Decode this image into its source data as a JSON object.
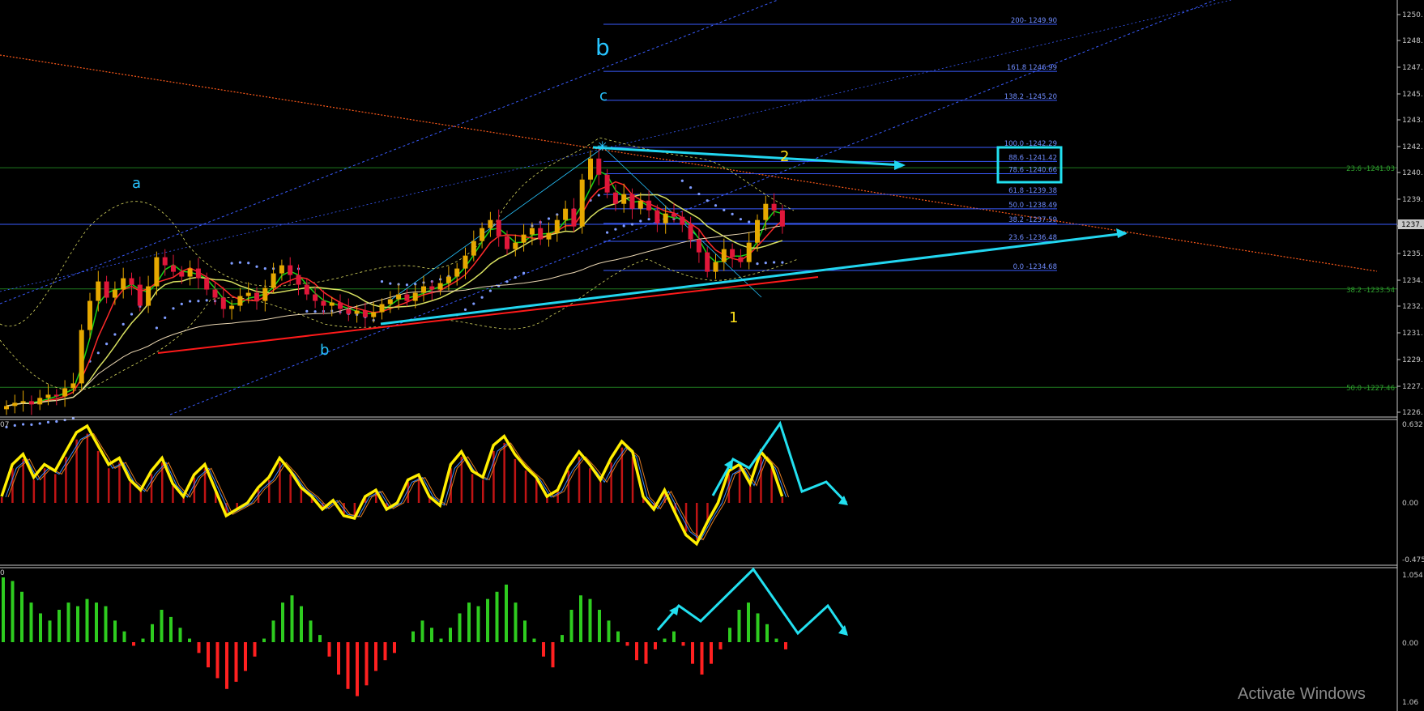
{
  "colors": {
    "background": "#000000",
    "axis_text": "#c8c8c8",
    "fib_blue": "#3a5cff",
    "fib_green": "#1f7a1f",
    "wave_cyan": "#27c4ff",
    "wave_yellow": "#ffe11a",
    "projection_cyan": "#22e0f0",
    "trend_red": "#ff1a1a",
    "bull_candle": "#e6a800",
    "bear_candle": "#e0173a",
    "hist_green": "#2ecc1f",
    "hist_red": "#ff2020",
    "osc_yellow": "#ffee00"
  },
  "price_axis": {
    "labels": [
      "1250.",
      "1248.",
      "1247.",
      "1245.",
      "1243.",
      "1242.",
      "1240.",
      "1239.",
      "1237.",
      "1235.",
      "1234.",
      "1232.",
      "1231.",
      "1229.",
      "1227.",
      "1226."
    ],
    "current_price": "1237."
  },
  "fib_levels": [
    {
      "label": "200- 1249.90"
    },
    {
      "label": "161.8  1246.99"
    },
    {
      "label": "138.2  -1245.20"
    },
    {
      "label": "100.0 -1242.29"
    },
    {
      "label": "88.6 -1241.42"
    },
    {
      "label": "78.6 -1240.66"
    },
    {
      "label": "61.8 -1239.38"
    },
    {
      "label": "50.0 -1238.49"
    },
    {
      "label": "38.2 -1237.59"
    },
    {
      "label": "23.6 -1236.48"
    },
    {
      "label": "0.0 -1234.68"
    }
  ],
  "fib_green_levels": [
    {
      "label": "23.6 -1241.03"
    },
    {
      "label": "38.2 -1233.54"
    },
    {
      "label": "50.0 -1227.46"
    }
  ],
  "wave_labels": {
    "a": "a",
    "b_big": "b",
    "b_small": "b",
    "c": "c",
    "one": "1",
    "two": "2"
  },
  "oscillator": {
    "top_value": "0.632",
    "zero_value": "0.00",
    "bottom_value": "-0.475",
    "left_fragment": "07"
  },
  "histogram": {
    "top_value": "1.054",
    "zero_value": "0.00",
    "bottom_value": "1.06",
    "left_fragment": "0"
  },
  "watermark": "Activate Windows",
  "chart_data": [
    {
      "type": "candlestick",
      "panel": "price",
      "title": "",
      "ylim": [
        1226,
        1251
      ],
      "fib_retracement": [
        {
          "ratio": 200,
          "price": 1249.9
        },
        {
          "ratio": 161.8,
          "price": 1246.99
        },
        {
          "ratio": 138.2,
          "price": 1245.2
        },
        {
          "ratio": 100.0,
          "price": 1242.29
        },
        {
          "ratio": 88.6,
          "price": 1241.42
        },
        {
          "ratio": 78.6,
          "price": 1240.66
        },
        {
          "ratio": 61.8,
          "price": 1239.38
        },
        {
          "ratio": 50.0,
          "price": 1238.49
        },
        {
          "ratio": 38.2,
          "price": 1237.59
        },
        {
          "ratio": 23.6,
          "price": 1236.48
        },
        {
          "ratio": 0.0,
          "price": 1234.68
        }
      ],
      "fib_secondary": [
        {
          "ratio": 23.6,
          "price": 1241.03
        },
        {
          "ratio": 38.2,
          "price": 1233.54
        },
        {
          "ratio": 50.0,
          "price": 1227.46
        }
      ],
      "closes": [
        1226.3,
        1226.5,
        1226.6,
        1226.4,
        1226.8,
        1227.0,
        1226.9,
        1227.4,
        1227.7,
        1231.0,
        1232.8,
        1234.0,
        1233.0,
        1233.5,
        1234.2,
        1233.8,
        1232.5,
        1233.7,
        1235.5,
        1235.0,
        1234.6,
        1234.3,
        1234.8,
        1234.2,
        1233.5,
        1233.0,
        1232.3,
        1232.5,
        1233.1,
        1233.3,
        1232.8,
        1233.6,
        1234.5,
        1235.0,
        1234.4,
        1233.8,
        1233.2,
        1232.8,
        1232.5,
        1232.7,
        1232.3,
        1232.0,
        1232.2,
        1231.8,
        1232.1,
        1232.6,
        1232.9,
        1233.2,
        1232.8,
        1233.3,
        1233.7,
        1233.5,
        1233.9,
        1234.3,
        1234.8,
        1235.6,
        1236.5,
        1237.3,
        1237.8,
        1236.8,
        1236.0,
        1236.4,
        1236.9,
        1237.3,
        1236.6,
        1237.0,
        1237.8,
        1238.5,
        1237.4,
        1240.3,
        1241.6,
        1240.6,
        1239.5,
        1238.8,
        1239.4,
        1238.5,
        1239.0,
        1238.4,
        1237.6,
        1238.2,
        1238.0,
        1237.5,
        1236.6,
        1235.8,
        1234.6,
        1235.2,
        1236.0,
        1235.5,
        1235.2,
        1236.4,
        1237.8,
        1238.8,
        1238.4,
        1237.4
      ],
      "moving_average_colors": [
        "#17d117",
        "#ff2a2a",
        "#d8e060",
        "#ead6b2"
      ],
      "trendlines": [
        {
          "name": "support",
          "color": "#22d6f0"
        },
        {
          "name": "resistance",
          "color": "#ff5a1a"
        }
      ]
    },
    {
      "type": "line",
      "panel": "oscillator",
      "ylim": [
        -0.475,
        0.632
      ],
      "series": [
        {
          "color": "#ffee00",
          "values": [
            0.05,
            0.3,
            0.38,
            0.2,
            0.3,
            0.25,
            0.4,
            0.55,
            0.6,
            0.45,
            0.3,
            0.35,
            0.18,
            0.1,
            0.25,
            0.35,
            0.15,
            0.05,
            0.22,
            0.3,
            0.1,
            -0.1,
            -0.05,
            0.0,
            0.12,
            0.2,
            0.35,
            0.25,
            0.12,
            0.05,
            -0.05,
            0.02,
            -0.1,
            -0.12,
            0.05,
            0.1,
            -0.05,
            0.0,
            0.18,
            0.22,
            0.05,
            -0.02,
            0.3,
            0.4,
            0.25,
            0.2,
            0.45,
            0.52,
            0.38,
            0.28,
            0.2,
            0.05,
            0.1,
            0.28,
            0.4,
            0.3,
            0.18,
            0.35,
            0.48,
            0.4,
            0.05,
            -0.05,
            0.1,
            -0.08,
            -0.25,
            -0.32,
            -0.15,
            0.0,
            0.25,
            0.3,
            0.15,
            0.4,
            0.3,
            0.05
          ]
        }
      ],
      "histogram_color": "#c01414"
    },
    {
      "type": "bar",
      "panel": "histogram",
      "ylim": [
        -0.6,
        1.054
      ],
      "values": [
        0.9,
        0.85,
        0.7,
        0.55,
        0.4,
        0.3,
        0.45,
        0.55,
        0.5,
        0.6,
        0.55,
        0.5,
        0.3,
        0.15,
        -0.05,
        0.05,
        0.25,
        0.45,
        0.35,
        0.2,
        0.05,
        -0.15,
        -0.35,
        -0.5,
        -0.65,
        -0.55,
        -0.4,
        -0.2,
        0.05,
        0.3,
        0.55,
        0.65,
        0.5,
        0.3,
        0.1,
        -0.2,
        -0.45,
        -0.65,
        -0.75,
        -0.6,
        -0.4,
        -0.25,
        -0.15,
        0.0,
        0.15,
        0.3,
        0.2,
        0.05,
        0.2,
        0.4,
        0.55,
        0.5,
        0.6,
        0.7,
        0.8,
        0.55,
        0.3,
        0.05,
        -0.2,
        -0.35,
        0.1,
        0.45,
        0.65,
        0.6,
        0.45,
        0.3,
        0.15,
        -0.05,
        -0.25,
        -0.3,
        -0.1,
        0.05,
        0.15,
        -0.05,
        -0.3,
        -0.45,
        -0.3,
        -0.1,
        0.2,
        0.45,
        0.55,
        0.4,
        0.25,
        0.05,
        -0.1
      ]
    }
  ]
}
